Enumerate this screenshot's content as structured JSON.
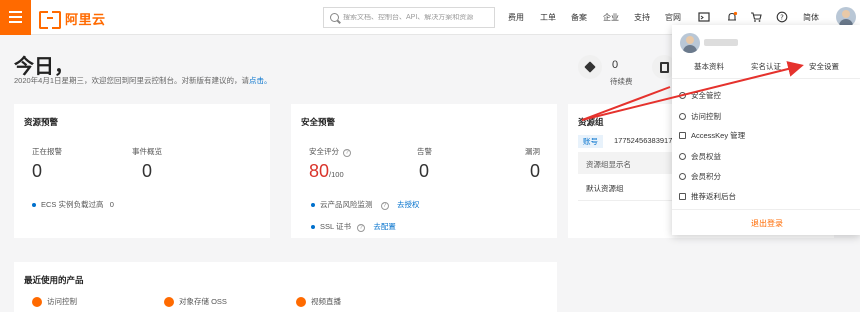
{
  "topbar": {
    "logo_text": "阿里云",
    "search_placeholder": "搜索文档、控制台、API、解决方案和资源",
    "nav": [
      "费用",
      "工单",
      "备案",
      "企业",
      "支持",
      "官网"
    ],
    "lang": "简体",
    "accent": "#ff6a00"
  },
  "greeting": {
    "title": "今日，",
    "subtitle": "2020年4月1日星期三，欢迎您回到阿里云控制台。对新版有建议的，请",
    "link": "点击。"
  },
  "stats": [
    {
      "value": "0",
      "label": "待续费"
    }
  ],
  "resource_alert": {
    "title": "资源预警",
    "col1_label": "正在报警",
    "col1_value": "0",
    "col2_label": "事件概览",
    "col2_value": "0",
    "item_label": "ECS 实例负载过高",
    "item_value": "0"
  },
  "security_alert": {
    "title": "安全预警",
    "score_label": "安全评分",
    "score_value": "80",
    "score_total": "/100",
    "warn_label": "告警",
    "warn_value": "0",
    "vuln_label": "漏洞",
    "vuln_value": "0",
    "item1_label": "云产品风险监测",
    "item1_link": "去授权",
    "item2_label": "SSL 证书",
    "item2_link": "去配置"
  },
  "resource_group": {
    "title": "资源组",
    "account_tag": "账号",
    "account_id": "17752456383917",
    "col_header": "资源组显示名",
    "row1": "默认资源组"
  },
  "recent_products": {
    "title": "最近使用的产品",
    "items": [
      "访问控制",
      "对象存储 OSS",
      "视频直播"
    ]
  },
  "dropdown": {
    "tabs": [
      "基本资料",
      "实名认证",
      "安全设置"
    ],
    "items": [
      "安全管控",
      "访问控制",
      "AccessKey 管理",
      "会员权益",
      "会员积分",
      "推荐返利后台"
    ],
    "logout": "退出登录"
  },
  "annotation_color": "#e5322d"
}
